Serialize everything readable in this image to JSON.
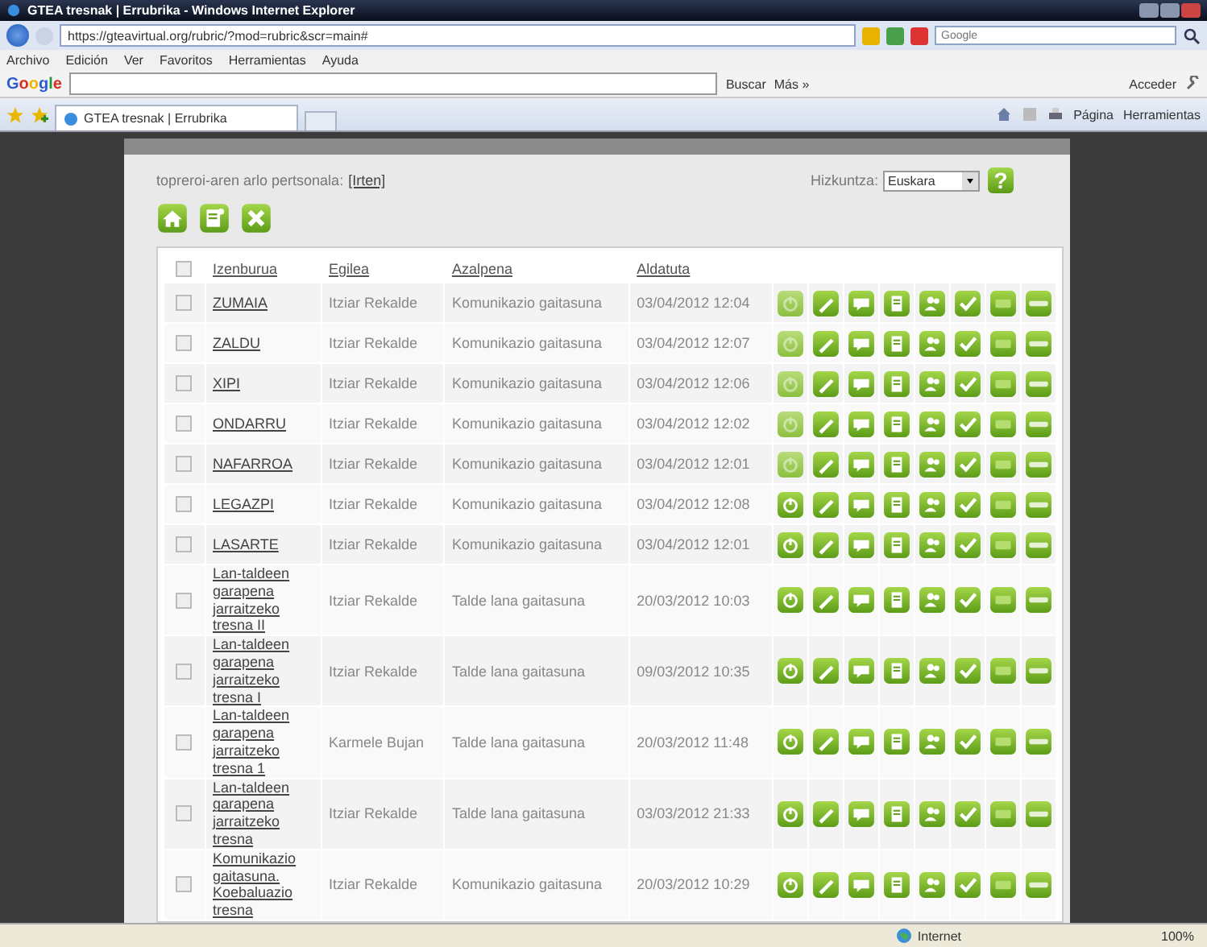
{
  "window": {
    "title": "GTEA tresnak | Errubrika - Windows Internet Explorer"
  },
  "address_bar": {
    "url": "https://gteavirtual.org/rubric/?mod=rubric&scr=main#"
  },
  "search_field": {
    "placeholder": "Google"
  },
  "menu": [
    "Archivo",
    "Edición",
    "Ver",
    "Favoritos",
    "Herramientas",
    "Ayuda"
  ],
  "google_toolbar": {
    "logo": "Google",
    "buttons": [
      "Buscar",
      "Más »"
    ],
    "sign_in": "Acceder"
  },
  "tab": {
    "title": "GTEA tresnak | Errubrika"
  },
  "command_bar": [
    "Página",
    "Herramientas"
  ],
  "page": {
    "user_text": "topreroi-aren arlo pertsonala:",
    "logout_link": "[Irten]",
    "language_label": "Hizkuntza:",
    "language": "Euskara",
    "help_button": "?"
  },
  "table": {
    "select_all": {
      "checked": false
    },
    "columns": [
      "Izenburua",
      "Egilea",
      "Azalpena",
      "Aldatuta"
    ],
    "rows": [
      {
        "title": "ZUMAIA",
        "author": "Itziar Rekalde",
        "description": "Komunikazio gaitasuna",
        "modified": "03/04/2012 12:04",
        "checked": false,
        "active": false
      },
      {
        "title": "ZALDU",
        "author": "Itziar Rekalde",
        "description": "Komunikazio gaitasuna",
        "modified": "03/04/2012 12:07",
        "checked": false,
        "active": false
      },
      {
        "title": "XIPI",
        "author": "Itziar Rekalde",
        "description": "Komunikazio gaitasuna",
        "modified": "03/04/2012 12:06",
        "checked": false,
        "active": false
      },
      {
        "title": "ONDARRU",
        "author": "Itziar Rekalde",
        "description": "Komunikazio gaitasuna",
        "modified": "03/04/2012 12:02",
        "checked": false,
        "active": false
      },
      {
        "title": "NAFARROA",
        "author": "Itziar Rekalde",
        "description": "Komunikazio gaitasuna",
        "modified": "03/04/2012 12:01",
        "checked": false,
        "active": false
      },
      {
        "title": "LEGAZPI",
        "author": "Itziar Rekalde",
        "description": "Komunikazio gaitasuna",
        "modified": "03/04/2012 12:08",
        "checked": false,
        "active": true
      },
      {
        "title": "LASARTE",
        "author": "Itziar Rekalde",
        "description": "Komunikazio gaitasuna",
        "modified": "03/04/2012 12:01",
        "checked": false,
        "active": true
      },
      {
        "title": "Lan-taldeen garapena jarraitzeko tresna II",
        "author": "Itziar Rekalde",
        "description": "Talde lana gaitasuna",
        "modified": "20/03/2012 10:03",
        "checked": false,
        "active": true
      },
      {
        "title": "Lan-taldeen garapena jarraitzeko tresna I",
        "author": "Itziar Rekalde",
        "description": "Talde lana gaitasuna",
        "modified": "09/03/2012 10:35",
        "checked": false,
        "active": true
      },
      {
        "title": "Lan-taldeen garapena jarraitzeko tresna 1",
        "author": "Karmele Bujan",
        "description": "Talde lana gaitasuna",
        "modified": "20/03/2012 11:48",
        "checked": false,
        "active": true
      },
      {
        "title": "Lan-taldeen garapena jarraitzeko tresna",
        "author": "Itziar Rekalde",
        "description": "Talde lana gaitasuna",
        "modified": "03/03/2012 21:33",
        "checked": false,
        "active": true
      },
      {
        "title": "Komunikazio gaitasuna. Koebaluazio tresna",
        "author": "Itziar Rekalde",
        "description": "Komunikazio gaitasuna",
        "modified": "20/03/2012 10:29",
        "checked": false,
        "active": true
      }
    ]
  },
  "status_bar": {
    "zone": "Internet",
    "zoom": "100%"
  }
}
